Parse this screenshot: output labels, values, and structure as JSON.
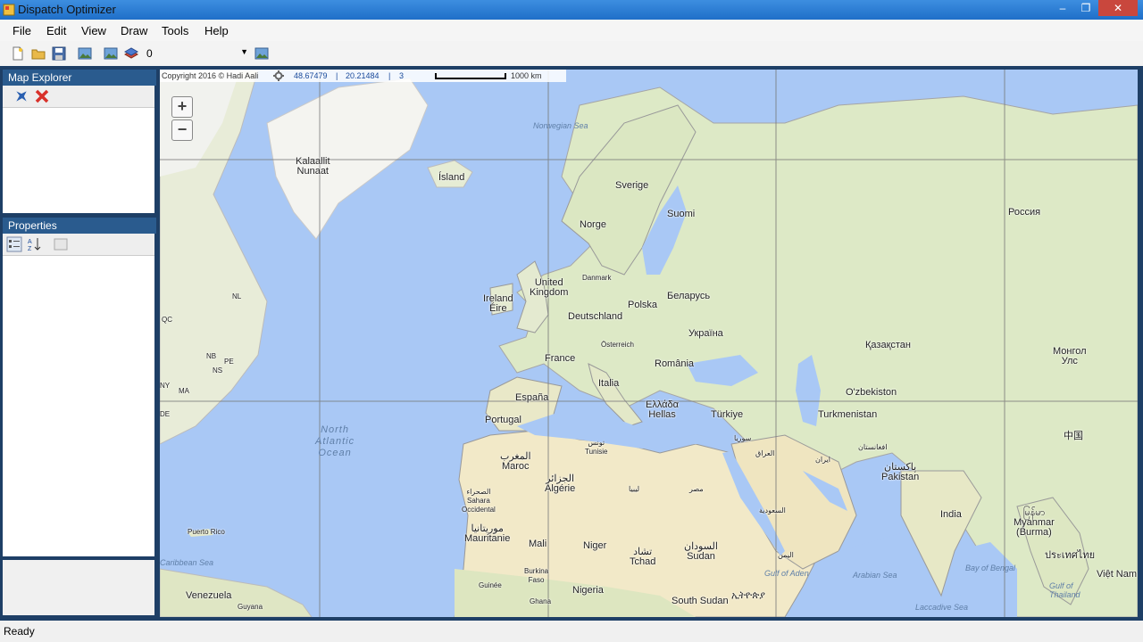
{
  "window": {
    "title": "Dispatch Optimizer",
    "buttons": [
      "–",
      "❐",
      "✕"
    ]
  },
  "menu": [
    "File",
    "Edit",
    "View",
    "Draw",
    "Tools",
    "Help"
  ],
  "toolbar": {
    "icons": [
      "new-file-icon",
      "open-folder-icon",
      "save-icon",
      "map-image-icon",
      "map-image-icon",
      "layers-icon",
      "map-image-icon"
    ],
    "combo_value": "0"
  },
  "map_explorer": {
    "title": "Map Explorer",
    "tools": [
      "airplane-icon",
      "delete-icon"
    ]
  },
  "properties": {
    "title": "Properties",
    "tools": [
      "categorized-icon",
      "sort-az-icon",
      "property-pages-icon"
    ]
  },
  "map": {
    "info": {
      "copyright": "Copyright 2016 © Hadi Aali",
      "longitude": "48.67479",
      "latitude": "20.21484",
      "zoom": "3",
      "scale": "1000 km"
    },
    "labels": {
      "greenland": "Kalaallit\nNunaat",
      "iceland": "Ísland",
      "sverige": "Sverige",
      "suomi": "Suomi",
      "norge": "Norge",
      "rossiya": "Россия",
      "danmark": "Danmark",
      "uk": "United\nKingdom",
      "ireland": "Ireland\nÉire",
      "belarus": "Беларусь",
      "deutschland": "Deutschland",
      "polska": "Polska",
      "ukraina": "Україна",
      "osterreich": "Österreich",
      "france": "France",
      "romania": "România",
      "kazakhstan": "Қазақстан",
      "mongolia": "Монгол\nУлс",
      "italia": "Italia",
      "espana": "España",
      "portugal": "Portugal",
      "ellada": "Ελλάδα\nHellas",
      "turkiye": "Türkiye",
      "uzbekistan": "O'zbekiston",
      "turkmenistan": "Turkmenistan",
      "china": "中国",
      "tunisia": "تونس\nTunisie",
      "syria": "سوريا",
      "iraq": "العراق",
      "iran": "ایران",
      "afghanistan": "افغانستان",
      "pakistan": "پاکستان\nPakistan",
      "maroc": "المغرب\nMaroc",
      "algerie": "الجزائر\nAlgérie",
      "libya": "ليبيا",
      "egypt": "مصر",
      "saudi": "السعودية",
      "india": "India",
      "western_sahara": "الصحراء\nSahara\nOccidental",
      "mauritanie": "موريتانيا\nMauritanie",
      "mali": "Mali",
      "niger": "Niger",
      "tchad": "تشاد\nTchad",
      "sudan": "السودان\nSudan",
      "yemen": "اليمن",
      "myanmar": "မြန်မာ\nMyanmar\n(Burma)",
      "thailand": "ประเทศไทย",
      "vietnam": "Việt Nam",
      "burkina": "Burkina\nFaso",
      "guinee": "Guinée",
      "ghana": "Ghana",
      "nigeria": "Nigeria",
      "ethiopia": "ኢትዮጵያ",
      "south_sudan": "South Sudan",
      "puerto_rico": "Puerto Rico",
      "venezuela": "Venezuela",
      "guyana": "Guyana",
      "qc": "QC",
      "nl": "NL",
      "nb": "NB",
      "pe": "PE",
      "ns": "NS",
      "ny": "NY",
      "ma": "MA",
      "de": "DE"
    },
    "seas": {
      "norwegian": "Norwegian Sea",
      "atlantic": "North\nAtlantic\nOcean",
      "aden": "Gulf of Aden",
      "arabian": "Arabian Sea",
      "bengal": "Bay of Bengal",
      "gulf_thailand": "Gulf of\nThailand",
      "laccadive": "Laccadive Sea",
      "caribbean": "Caribbean Sea"
    }
  },
  "status": {
    "text": "Ready"
  }
}
